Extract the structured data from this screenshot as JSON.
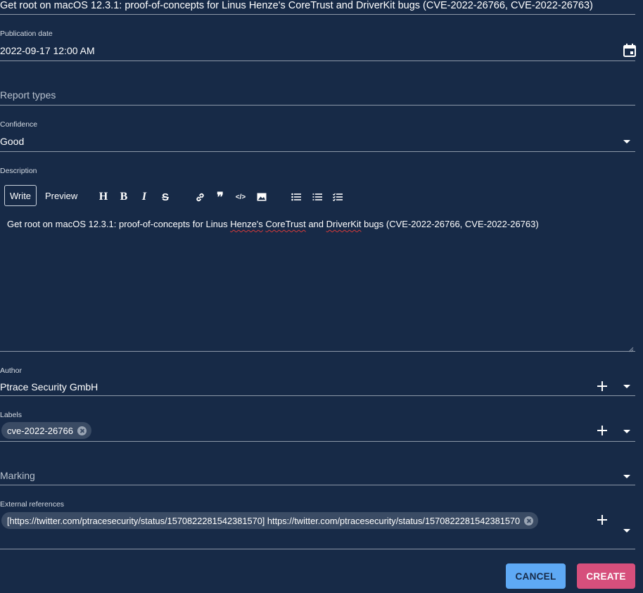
{
  "title_field": {
    "value": "Get root on macOS 12.3.1: proof-of-concepts for Linus Henze's CoreTrust and DriverKit bugs (CVE-2022-26766, CVE-2022-26763)"
  },
  "publication_date": {
    "label": "Publication date",
    "value": "2022-09-17 12:00 AM",
    "icon": "calendar-icon"
  },
  "report_types": {
    "placeholder": "Report types"
  },
  "confidence": {
    "label": "Confidence",
    "value": "Good"
  },
  "description": {
    "label": "Description",
    "tabs": {
      "write": "Write",
      "preview": "Preview"
    },
    "toolbar": [
      "heading-icon",
      "bold-icon",
      "italic-icon",
      "strikethrough-icon",
      "link-icon",
      "quote-icon",
      "code-icon",
      "image-icon",
      "bulleted-list-icon",
      "numbered-list-icon",
      "checklist-icon"
    ],
    "text_parts": {
      "p1": "Get root on macOS 12.3.1: proof-of-concepts for Linus ",
      "w1": "Henze's",
      "p2": " ",
      "w2": "CoreTrust",
      "p3": " and ",
      "w3": "DriverKit",
      "p4": " bugs (CVE-2022-26766, CVE-2022-26763)"
    }
  },
  "author": {
    "label": "Author",
    "value": "Ptrace Security GmbH"
  },
  "labels": {
    "label": "Labels",
    "chips": [
      "cve-2022-26766"
    ]
  },
  "marking": {
    "placeholder": "Marking"
  },
  "external_references": {
    "label": "External references",
    "chips": [
      "[https://twitter.com/ptracesecurity/status/1570822281542381570] https://twitter.com/ptracesecurity/status/1570822281542381570"
    ]
  },
  "actions": {
    "cancel": "CANCEL",
    "create": "CREATE"
  },
  "colors": {
    "background": "#172a47",
    "cancel_button": "#5ea9f5",
    "create_button": "#d64f7c"
  }
}
